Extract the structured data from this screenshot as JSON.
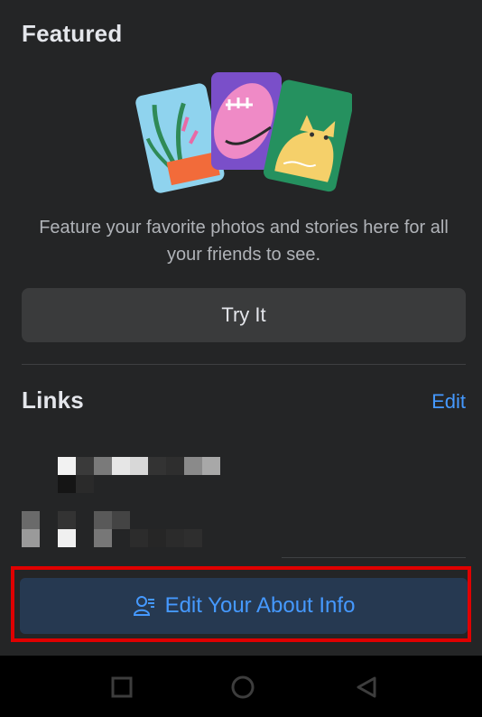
{
  "featured": {
    "title": "Featured",
    "description": "Feature your favorite photos and stories here for all your friends to see.",
    "try_label": "Try It",
    "illustration": "featured-cards-illustration"
  },
  "links": {
    "title": "Links",
    "edit_label": "Edit"
  },
  "about_button": {
    "label": "Edit Your About Info",
    "icon": "person-info-icon"
  },
  "navbar": {
    "recents_icon": "square-icon",
    "home_icon": "circle-icon",
    "back_icon": "triangle-back-icon"
  },
  "colors": {
    "background": "#242526",
    "button": "#3a3b3c",
    "accent": "#4599ff",
    "about_button_bg": "#263951",
    "highlight": "#e00000"
  }
}
